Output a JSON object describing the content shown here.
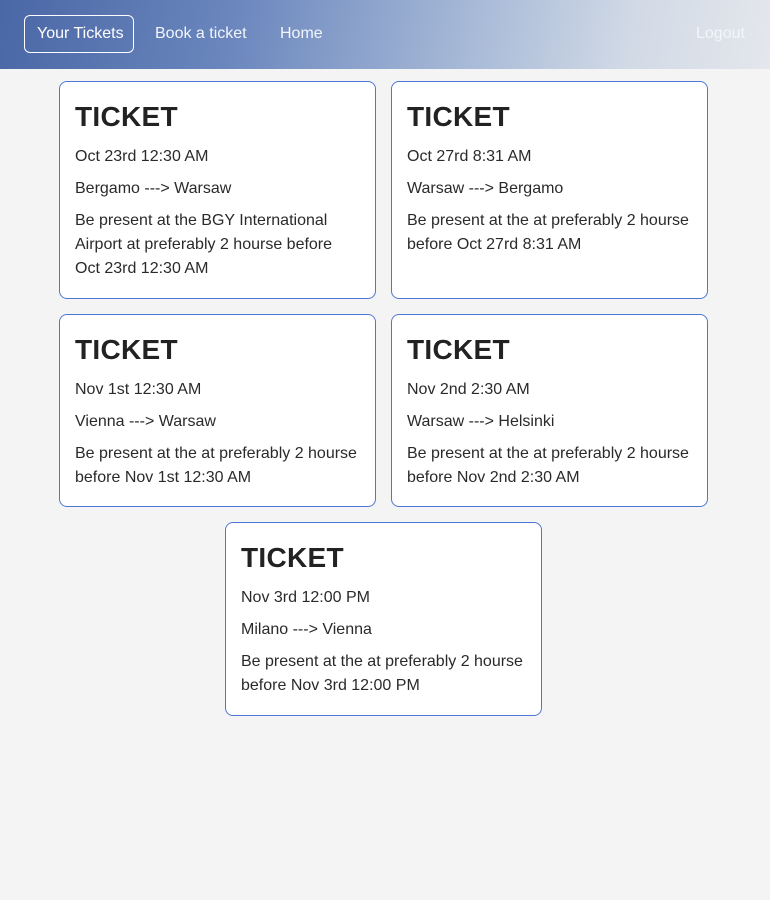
{
  "nav": {
    "your_tickets": "Your Tickets",
    "book_ticket": "Book a ticket",
    "home": "Home",
    "logout": "Logout"
  },
  "tickets": [
    {
      "title": "TICKET",
      "date": "Oct 23rd 12:30 AM",
      "route": "Bergamo ---> Warsaw",
      "note": "Be present at the BGY International Airport at preferably 2 hourse before Oct 23rd 12:30 AM"
    },
    {
      "title": "TICKET",
      "date": "Oct 27rd 8:31 AM",
      "route": "Warsaw ---> Bergamo",
      "note": "Be present at the at preferably 2 hourse before Oct 27rd 8:31 AM"
    },
    {
      "title": "TICKET",
      "date": "Nov 1st 12:30 AM",
      "route": "Vienna ---> Warsaw",
      "note": "Be present at the at preferably 2 hourse before Nov 1st 12:30 AM"
    },
    {
      "title": "TICKET",
      "date": "Nov 2nd 2:30 AM",
      "route": "Warsaw ---> Helsinki",
      "note": "Be present at the at preferably 2 hourse before Nov 2nd 2:30 AM"
    },
    {
      "title": "TICKET",
      "date": "Nov 3rd 12:00 PM",
      "route": "Milano ---> Vienna",
      "note": "Be present at the at preferably 2 hourse before Nov 3rd 12:00 PM"
    }
  ],
  "colors": {
    "card_border": "#4f76d6",
    "page_background": "#f4f4f4",
    "navbar_start": "#4a67a6",
    "navbar_end": "#e4e7ec"
  }
}
